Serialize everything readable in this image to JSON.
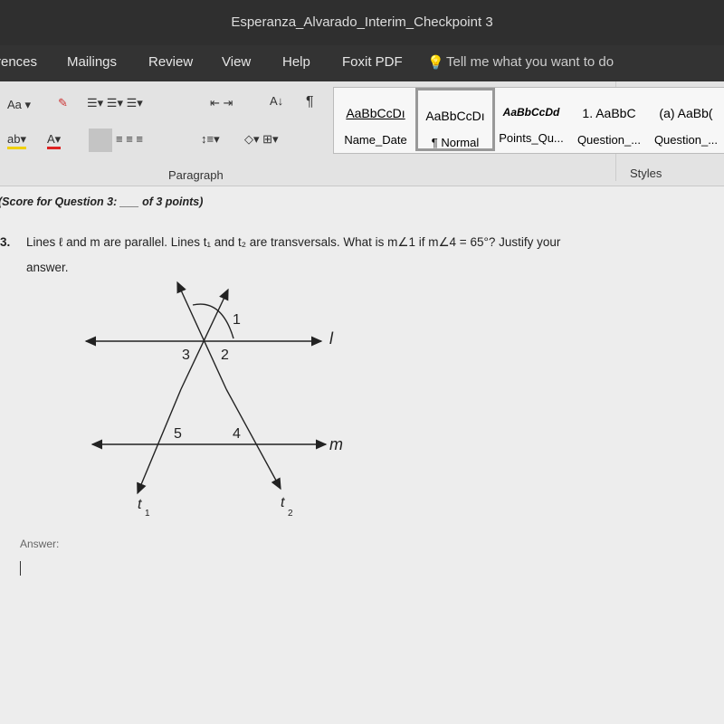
{
  "window": {
    "title": "Esperanza_Alvarado_Interim_Checkpoint 3"
  },
  "tabs": [
    "rences",
    "Mailings",
    "Review",
    "View",
    "Help",
    "Foxit PDF"
  ],
  "tell_me": "Tell me what you want to do",
  "ribbon": {
    "font_size_btn": "Aa",
    "paragraph_label": "Paragraph",
    "styles_label": "Styles",
    "styles": [
      {
        "sample": "AaBbCcDı",
        "name": "Name_Date"
      },
      {
        "sample": "AaBbCcDı",
        "name": "¶ Normal",
        "selected": true
      },
      {
        "sample": "AaBbCcDd",
        "name": "Points_Qu..."
      },
      {
        "sample": "1. AaBbC",
        "name": "Question_..."
      },
      {
        "sample": "(a) AaBb(",
        "name": "Question_..."
      }
    ]
  },
  "document": {
    "score": "(Score for Question 3: ___ of 3 points)",
    "question_number": "3.",
    "question_line1": "Lines ℓ and m are parallel. Lines t₁ and t₂ are transversals. What is m∠1 if m∠4 = 65°? Justify your",
    "question_line2": "answer.",
    "answer_label": "Answer:",
    "diagram": {
      "angle_labels": [
        "1",
        "2",
        "3",
        "4",
        "5"
      ],
      "line_labels": [
        "l",
        "m",
        "t",
        "1",
        "t",
        "2"
      ]
    }
  }
}
